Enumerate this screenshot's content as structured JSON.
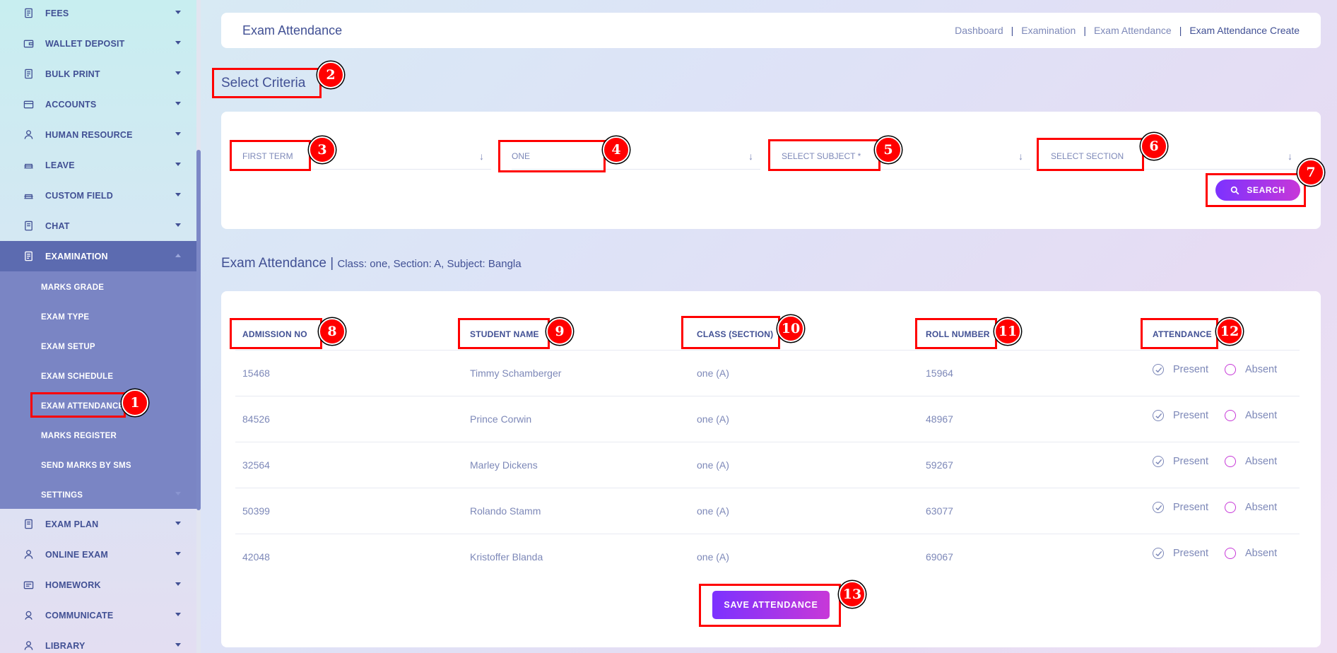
{
  "sidebar": {
    "items": [
      {
        "label": "FEES",
        "icon": "fees-icon"
      },
      {
        "label": "WALLET DEPOSIT",
        "icon": "wallet-icon"
      },
      {
        "label": "BULK PRINT",
        "icon": "print-icon"
      },
      {
        "label": "ACCOUNTS",
        "icon": "accounts-icon"
      },
      {
        "label": "HUMAN RESOURCE",
        "icon": "human-resource-icon"
      },
      {
        "label": "LEAVE",
        "icon": "leave-icon"
      },
      {
        "label": "CUSTOM FIELD",
        "icon": "custom-field-icon"
      },
      {
        "label": "CHAT",
        "icon": "chat-icon"
      },
      {
        "label": "EXAMINATION",
        "icon": "examination-icon"
      },
      {
        "label": "EXAM PLAN",
        "icon": "exam-plan-icon"
      },
      {
        "label": "ONLINE EXAM",
        "icon": "online-exam-icon"
      },
      {
        "label": "HOMEWORK",
        "icon": "homework-icon"
      },
      {
        "label": "COMMUNICATE",
        "icon": "communicate-icon"
      },
      {
        "label": "LIBRARY",
        "icon": "library-icon"
      }
    ],
    "submenu": [
      "MARKS GRADE",
      "EXAM TYPE",
      "EXAM SETUP",
      "EXAM SCHEDULE",
      "EXAM ATTENDANCE",
      "MARKS REGISTER",
      "SEND MARKS BY SMS",
      "SETTINGS"
    ]
  },
  "header": {
    "title": "Exam Attendance",
    "breadcrumb": [
      "Dashboard",
      "Examination",
      "Exam Attendance",
      "Exam Attendance Create"
    ],
    "separator": "|"
  },
  "criteria": {
    "title": "Select Criteria",
    "fields": [
      "FIRST TERM",
      "ONE",
      "SELECT SUBJECT *",
      "SELECT SECTION"
    ],
    "search_label": "SEARCH"
  },
  "attendance": {
    "title": "Exam Attendance |",
    "subtitle": "Class: one, Section: A, Subject: Bangla",
    "columns": [
      "ADMISSION NO",
      "STUDENT NAME",
      "CLASS (SECTION)",
      "ROLL NUMBER",
      "ATTENDANCE"
    ],
    "rows": [
      {
        "admission": "15468",
        "name": "Timmy Schamberger",
        "class": "one (A)",
        "roll": "15964"
      },
      {
        "admission": "84526",
        "name": "Prince Corwin",
        "class": "one (A)",
        "roll": "48967"
      },
      {
        "admission": "32564",
        "name": "Marley Dickens",
        "class": "one (A)",
        "roll": "59267"
      },
      {
        "admission": "50399",
        "name": "Rolando Stamm",
        "class": "one (A)",
        "roll": "63077"
      },
      {
        "admission": "42048",
        "name": "Kristoffer Blanda",
        "class": "one (A)",
        "roll": "69067"
      }
    ],
    "present_label": "Present",
    "absent_label": "Absent",
    "save_label": "SAVE ATTENDANCE"
  },
  "annotations": [
    "1",
    "2",
    "3",
    "4",
    "5",
    "6",
    "7",
    "8",
    "9",
    "10",
    "11",
    "12",
    "13"
  ],
  "colors": {
    "accent_start": "#7c32ff",
    "accent_end": "#c738d8",
    "text_primary": "#415094",
    "annotation": "#ff0000"
  }
}
